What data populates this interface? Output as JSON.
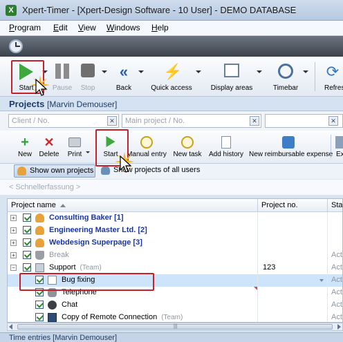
{
  "window": {
    "title": "Xpert-Timer - [Xpert-Design Software - 10 User] - DEMO DATABASE",
    "app_icon": "timer-app-icon"
  },
  "menu": {
    "program": {
      "u": "P",
      "rest": "rogram"
    },
    "edit": {
      "u": "E",
      "rest": "dit"
    },
    "view": {
      "u": "V",
      "rest": "iew"
    },
    "windows": {
      "u": "W",
      "rest": "indows"
    },
    "help": {
      "u": "H",
      "rest": "elp"
    }
  },
  "main_toolbar": {
    "start": "Start",
    "pause": "Pause",
    "stop": "Stop",
    "back": "Back",
    "quick_access": "Quick access",
    "display_areas": "Display areas",
    "timebar": "Timebar",
    "refresh": "Refres"
  },
  "projects_panel": {
    "title": "Projects",
    "user": "[Marvin Demouser]",
    "client_placeholder": "Client / No.",
    "main_project_placeholder": "Main project / No.",
    "toolbar": {
      "new": "New",
      "delete": "Delete",
      "print": "Print",
      "start": "Start",
      "manual_entry": "Manual entry",
      "new_task": "New task",
      "add_history": "Add history",
      "new_reimbursable_expense": "New reimbursable expense",
      "more": "Ex"
    },
    "show_own": "Show own projects",
    "show_all": "Show projects of all users",
    "quick_entry_placeholder": "< Schnellerfassung >",
    "columns": {
      "name": "Project name",
      "number": "Project no.",
      "status": "Stat"
    },
    "rows": [
      {
        "name": "Consulting Baker [1]",
        "number": "",
        "status": "",
        "icon": "person-icon"
      },
      {
        "name": "Engineering Master Ltd. [2]",
        "number": "",
        "status": "",
        "icon": "person-icon"
      },
      {
        "name": "Webdesign Superpage [3]",
        "number": "",
        "status": "",
        "icon": "person-icon"
      },
      {
        "name": "Break",
        "number": "",
        "status": "Acti",
        "icon": "cup-icon"
      },
      {
        "name": "Support",
        "team": "(Team)",
        "number": "123",
        "status": "Acti",
        "icon": "support-icon"
      },
      {
        "name": "Bug fixing",
        "number": "",
        "status": "Acti",
        "icon": "bug-icon"
      },
      {
        "name": "Telephone",
        "number": "",
        "status": "Acti",
        "icon": "phone-icon"
      },
      {
        "name": "Chat",
        "number": "",
        "status": "Acti",
        "icon": "chat-icon"
      },
      {
        "name": "Copy of Remote Connection",
        "team": "(Team)",
        "number": "",
        "status": "Acti",
        "icon": "monitor-icon"
      }
    ]
  },
  "footer": {
    "text": "Time entries [Marvin Demouser]"
  },
  "colors": {
    "highlight": "#c8202a",
    "selection": "#cde4fb",
    "client_text": "#1736a8"
  }
}
